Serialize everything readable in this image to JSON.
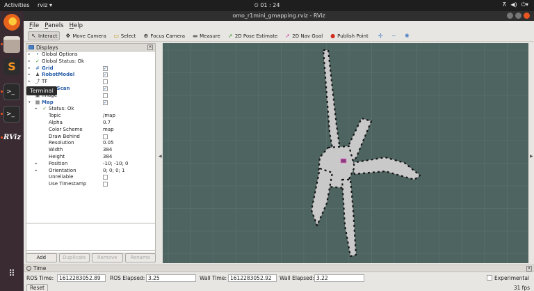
{
  "topbar": {
    "activities": "Activities",
    "app": "rviz ▾",
    "clock": "01 : 24"
  },
  "window": {
    "title": "omo_r1mini_gmapping.rviz - RViz"
  },
  "tooltip": "Terminal",
  "menu": [
    "File",
    "Panels",
    "Help"
  ],
  "toolbar": [
    {
      "label": "Interact",
      "icon": "pointer-icon",
      "active": true
    },
    {
      "label": "Move Camera",
      "icon": "camera-icon"
    },
    {
      "label": "Select",
      "icon": "select-box-icon"
    },
    {
      "label": "Focus Camera",
      "icon": "crosshair-icon"
    },
    {
      "label": "Measure",
      "icon": "ruler-icon"
    },
    {
      "label": "2D Pose Estimate",
      "icon": "green-arrow-icon"
    },
    {
      "label": "2D Nav Goal",
      "icon": "pink-arrow-icon"
    },
    {
      "label": "Publish Point",
      "icon": "pin-icon"
    }
  ],
  "displays": {
    "title": "Displays",
    "rows": [
      {
        "label": "Global Options",
        "indent": 0,
        "arrow": "▸",
        "icon": "•",
        "iconColor": "#4a7fc1"
      },
      {
        "label": "Global Status: Ok",
        "indent": 0,
        "arrow": "▸",
        "icon": "✓",
        "iconColor": "#3a8a2a"
      },
      {
        "label": "Grid",
        "indent": 0,
        "arrow": "▸",
        "icon": "#",
        "iconColor": "#4a7fc1",
        "blue": true,
        "check": "✓"
      },
      {
        "label": "RobotModel",
        "indent": 0,
        "arrow": "▸",
        "icon": "♟",
        "iconColor": "#555",
        "blue": true,
        "check": "✓"
      },
      {
        "label": "TF",
        "indent": 0,
        "arrow": "▸",
        "icon": "⤴",
        "iconColor": "#555",
        "check": ""
      },
      {
        "label": "LaserScan",
        "indent": 0,
        "arrow": "▸",
        "icon": "∴",
        "iconColor": "#c03030",
        "blue": true,
        "check": "✓"
      },
      {
        "label": "Image",
        "indent": 0,
        "arrow": "",
        "icon": "▣",
        "iconColor": "#555",
        "check": ""
      },
      {
        "label": "Map",
        "indent": 0,
        "arrow": "▾",
        "icon": "▦",
        "iconColor": "#555",
        "blue": true,
        "check": "✓"
      },
      {
        "label": "Status: Ok",
        "indent": 1,
        "arrow": "▸",
        "icon": "✓",
        "iconColor": "#3a8a2a"
      },
      {
        "label": "Topic",
        "indent": 1,
        "value": "/map"
      },
      {
        "label": "Alpha",
        "indent": 1,
        "value": "0.7"
      },
      {
        "label": "Color Scheme",
        "indent": 1,
        "value": "map"
      },
      {
        "label": "Draw Behind",
        "indent": 1,
        "check": ""
      },
      {
        "label": "Resolution",
        "indent": 1,
        "value": "0.05"
      },
      {
        "label": "Width",
        "indent": 1,
        "value": "384"
      },
      {
        "label": "Height",
        "indent": 1,
        "value": "384"
      },
      {
        "label": "Position",
        "indent": 1,
        "arrow": "▸",
        "value": "-10; -10; 0"
      },
      {
        "label": "Orientation",
        "indent": 1,
        "arrow": "▸",
        "value": "0; 0; 0; 1"
      },
      {
        "label": "Unreliable",
        "indent": 1,
        "check": ""
      },
      {
        "label": "Use Timestamp",
        "indent": 1,
        "check": ""
      }
    ],
    "buttons": [
      {
        "label": "Add",
        "disabled": false
      },
      {
        "label": "Duplicate",
        "disabled": true
      },
      {
        "label": "Remove",
        "disabled": true
      },
      {
        "label": "Rename",
        "disabled": true
      }
    ]
  },
  "time": {
    "title": "Time",
    "ros_time_label": "ROS Time:",
    "ros_time": "1612283052.89",
    "ros_elapsed_label": "ROS Elapsed:",
    "ros_elapsed": "3.25",
    "wall_time_label": "Wall Time:",
    "wall_time": "1612283052.92",
    "wall_elapsed_label": "Wall Elapsed:",
    "wall_elapsed": "3.22",
    "experimental_label": "Experimental",
    "reset_label": "Reset",
    "fps": "31 fps"
  },
  "dock": [
    {
      "name": "firefox-icon",
      "color": "#e8641c"
    },
    {
      "name": "files-icon",
      "color": "#b0a39a"
    },
    {
      "name": "sublime-icon",
      "color": "#f49624"
    },
    {
      "name": "terminal-icon",
      "color": "#2a2a2a"
    },
    {
      "name": "terminal2-icon",
      "color": "#2a2a2a"
    },
    {
      "name": "rviz-icon",
      "color": "#3a2b33"
    },
    {
      "name": "apps-grid-icon",
      "color": "#3a2b33"
    }
  ]
}
